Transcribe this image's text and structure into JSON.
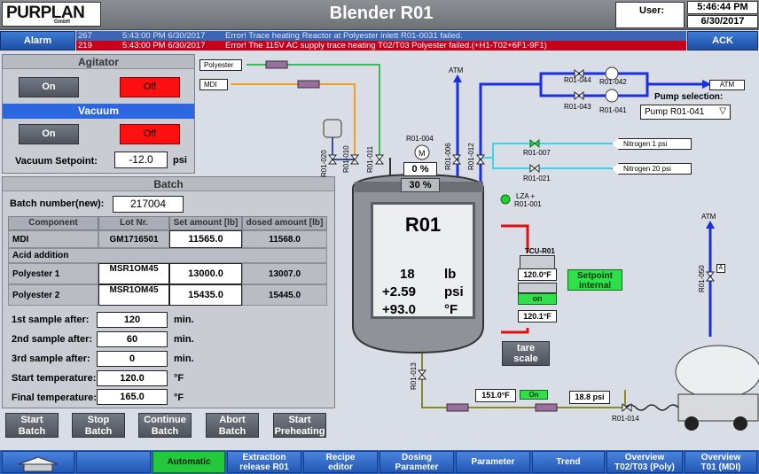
{
  "header": {
    "logo_text": "PURPLAN",
    "logo_sub": "GmbH",
    "title": "Blender R01",
    "user_label": "User:",
    "time": "5:46:44 PM",
    "date": "6/30/2017"
  },
  "alarms": {
    "button_label": "Alarm",
    "ack_label": "ACK",
    "rows": [
      {
        "id": "267",
        "time": "5:43:00 PM  6/30/2017",
        "text": "Error! Trace heating Reactor at Polyester inlett  R01-0031 failed."
      },
      {
        "id": "219",
        "time": "5:43:00 PM  6/30/2017",
        "text": "Error! The 115V AC supply trace heating  T02/T03 Polyester failed.(+H1-T02+6F1-9F1)"
      }
    ]
  },
  "agitator": {
    "title": "Agitator",
    "on_label": "On",
    "off_label": "Off"
  },
  "vacuum": {
    "title": "Vacuum",
    "on_label": "On",
    "off_label": "Off",
    "setpoint_label": "Vacuum Setpoint:",
    "setpoint_value": "-12.0",
    "setpoint_unit": "psi"
  },
  "batch": {
    "title": "Batch",
    "number_label": "Batch number(new):",
    "number_value": "217004",
    "columns": [
      "Component",
      "Lot Nr.",
      "Set amount [lb]",
      "dosed amount [lb]"
    ],
    "rows": [
      {
        "component": "MDI",
        "lot": "GM1716501",
        "set": "11565.0",
        "dosed": "11568.0"
      },
      {
        "component": "Polyester 1",
        "lot": "MSR1OM45",
        "set": "13000.0",
        "dosed": "13007.0"
      },
      {
        "component": "Polyester 2",
        "lot": "MSR1OM45",
        "set": "15435.0",
        "dosed": "15445.0"
      }
    ],
    "acid_label": "Acid addition",
    "params": [
      {
        "label": "1st sample after:",
        "value": "120",
        "unit": "min."
      },
      {
        "label": "2nd sample after:",
        "value": "60",
        "unit": "min."
      },
      {
        "label": "3rd sample after:",
        "value": "0",
        "unit": "min."
      },
      {
        "label": "Start temperature:",
        "value": "120.0",
        "unit": "°F"
      },
      {
        "label": "Final temperature:",
        "value": "165.0",
        "unit": "°F"
      }
    ],
    "actions": [
      [
        "Start",
        "Batch"
      ],
      [
        "Stop",
        "Batch"
      ],
      [
        "Continue",
        "Batch"
      ],
      [
        "Abort",
        "Batch"
      ],
      [
        "Start",
        "Preheating"
      ]
    ]
  },
  "diagram": {
    "polyester_label": "Polyester",
    "mdi_label": "MDI",
    "atm_label": "ATM",
    "atm2_label": "ATM",
    "atm3_label": "ATM",
    "pump_selection_label": "Pump selection:",
    "pump_selected": "Pump R01-041",
    "nitrogen1": "Nitrogen 1 psi",
    "nitrogen20": "Nitrogen 20 psi",
    "valves": {
      "v044": "R01-044",
      "v042": "R01-042",
      "v043": "R01-043",
      "v041": "R01-041",
      "v007": "R01-007",
      "v021": "R01-021",
      "v004": "R01-004",
      "v006": "R01-006",
      "v012": "R01-012",
      "v020": "R01-020",
      "v010": "R01-010",
      "v011": "R01-011",
      "v013": "R01-013",
      "v014": "R01-014",
      "v050": "R01-050"
    },
    "lza": [
      "LZA +",
      "R01-001"
    ],
    "agitator_speed": "0 %",
    "agitator_load": "30 %",
    "reactor": {
      "name": "R01",
      "weight": "18",
      "weight_unit": "lb",
      "pressure": "+2.59",
      "pressure_unit": "psi",
      "temp": "+93.0",
      "temp_unit": "°F"
    },
    "tcu": {
      "label": "TCU-R01",
      "setpoint": "120.0°F",
      "status": "on",
      "actual": "120.1°F",
      "internal_label": [
        "Setpoint",
        "internal"
      ]
    },
    "tare_label": [
      "tare",
      "scale"
    ],
    "line_temp": "151.0°F",
    "line_on": "On",
    "line_pressure": "18.8 psi",
    "truck_marker": "A"
  },
  "nav": {
    "items": [
      {
        "label": [
          "Automatic"
        ],
        "active": true
      },
      {
        "label": [
          "Extraction",
          "release R01"
        ]
      },
      {
        "label": [
          "Recipe",
          "editor"
        ]
      },
      {
        "label": [
          "Dosing",
          "Parameter"
        ]
      },
      {
        "label": [
          "Parameter"
        ]
      },
      {
        "label": [
          "Trend"
        ]
      },
      {
        "label": [
          "Overview",
          "T02/T03 (Poly)"
        ]
      },
      {
        "label": [
          "Overview",
          "T01 (MDI)"
        ]
      }
    ]
  },
  "colors": {
    "alarm_blue": "#3b65b5",
    "alarm_red": "#c4001a",
    "active_green": "#22c93a",
    "nav_blue": "#2b61c2",
    "off_red": "#ff1010"
  }
}
